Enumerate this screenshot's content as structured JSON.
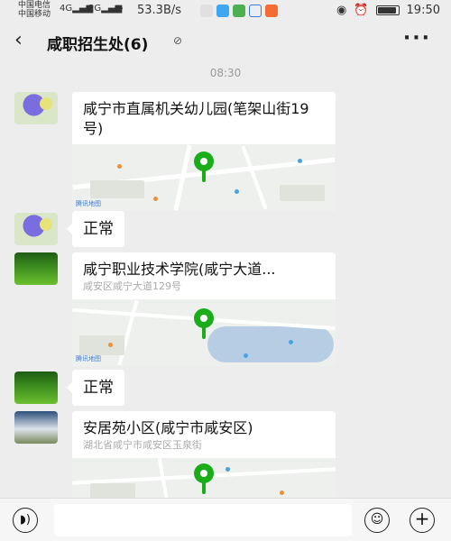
{
  "status_bar": {
    "carrier1": "中国电信",
    "carrier2": "中国移动",
    "signal1": "4G",
    "signal2": "2G",
    "speed": "53.3B/s",
    "time": "19:50",
    "battery_level": 0.85,
    "icons": [
      "signal-icon",
      "wifi-icon",
      "app-notification-icons",
      "eye-icon",
      "alarm-icon",
      "battery-icon"
    ]
  },
  "header": {
    "back_icon": "‹",
    "title": "咸职招生处(6)",
    "mute_icon": "mute-icon",
    "more_icon": "···"
  },
  "chat": {
    "timestamp": "08:30",
    "messages": [
      {
        "type": "location",
        "avatar": "purple-flower",
        "name": "咸宁市直属机关幼儿园(笔架山街19号)",
        "address": ""
      },
      {
        "type": "text",
        "avatar": "purple-flower",
        "text": "正常"
      },
      {
        "type": "location",
        "avatar": "grass-field",
        "name": "咸宁职业技术学院(咸宁大道...",
        "address": "咸安区咸宁大道129号"
      },
      {
        "type": "text",
        "avatar": "grass-field",
        "text": "正常"
      },
      {
        "type": "location",
        "avatar": "sunset",
        "name": "安居苑小区(咸宁市咸安区)",
        "address": "湖北省咸宁市咸安区玉泉街"
      }
    ],
    "map_brand": "腾讯地图"
  },
  "input_bar": {
    "voice_icon": "voice-icon",
    "input_value": "",
    "emoji_icon": "emoji-icon",
    "plus_icon": "plus-icon"
  },
  "colors": {
    "background": "#ededed",
    "pin_green": "#1aad19",
    "bubble": "#ffffff"
  }
}
